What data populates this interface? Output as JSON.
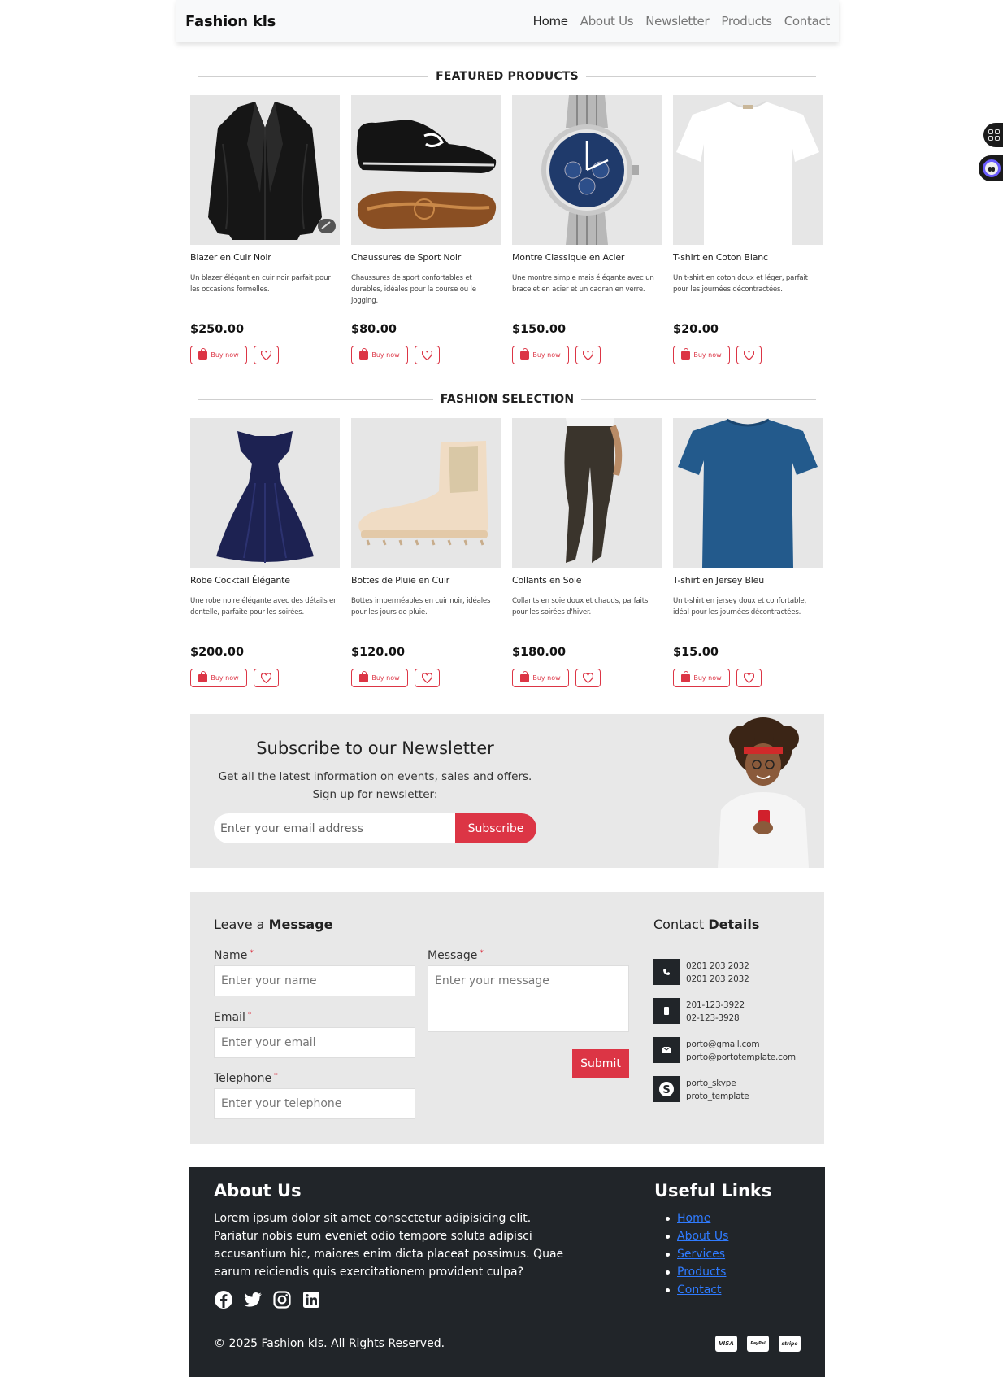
{
  "navbar": {
    "brand": "Fashion kls",
    "links": [
      {
        "label": "Home",
        "active": true
      },
      {
        "label": "About Us",
        "active": false
      },
      {
        "label": "Newsletter",
        "active": false
      },
      {
        "label": "Products",
        "active": false
      },
      {
        "label": "Contact",
        "active": false
      }
    ]
  },
  "featured": {
    "title": "FEATURED PRODUCTS",
    "products": [
      {
        "name": "Blazer en Cuir Noir",
        "desc": "Un blazer élégant en cuir noir parfait pour les occasions formelles.",
        "price": "$250.00",
        "image": "leather-jacket"
      },
      {
        "name": "Chaussures de Sport Noir",
        "desc": "Chaussures de sport confortables et durables, idéales pour la course ou le jogging.",
        "price": "$80.00",
        "image": "sport-shoes"
      },
      {
        "name": "Montre Classique en Acier",
        "desc": "Une montre simple mais élégante avec un bracelet en acier et un cadran en verre.",
        "price": "$150.00",
        "image": "steel-watch"
      },
      {
        "name": "T-shirt en Coton Blanc",
        "desc": "Un t-shirt en coton doux et léger, parfait pour les journées décontractées.",
        "price": "$20.00",
        "image": "white-tshirt"
      }
    ]
  },
  "fashion": {
    "title": "FASHION SELECTION",
    "products": [
      {
        "name": "Robe Cocktail Élégante",
        "desc": "Une robe noire élégante avec des détails en dentelle, parfaite pour les soirées.",
        "price": "$200.00",
        "image": "cocktail-dress"
      },
      {
        "name": "Bottes de Pluie en Cuir",
        "desc": "Bottes imperméables en cuir noir, idéales pour les jours de pluie.",
        "price": "$120.00",
        "image": "rain-boots"
      },
      {
        "name": "Collants en Soie",
        "desc": "Collants en soie doux et chauds, parfaits pour les soirées d'hiver.",
        "price": "$180.00",
        "image": "silk-tights"
      },
      {
        "name": "T-shirt en Jersey Bleu",
        "desc": "Un t-shirt en jersey doux et confortable, idéal pour les journées décontractées.",
        "price": "$15.00",
        "image": "blue-tshirt"
      }
    ]
  },
  "card": {
    "buy_label": "Buy now"
  },
  "newsletter": {
    "title": "Subscribe to our Newsletter",
    "line1": "Get all the latest information on events, sales and offers.",
    "line2": "Sign up for newsletter:",
    "placeholder": "Enter your email address",
    "button": "Subscribe"
  },
  "contact": {
    "title_light": "Leave a ",
    "title_bold": "Message",
    "name_label": "Name",
    "name_placeholder": "Enter your name",
    "email_label": "Email",
    "email_placeholder": "Enter your email",
    "phone_label": "Telephone",
    "phone_placeholder": "Enter your telephone",
    "message_label": "Message",
    "message_placeholder": "Enter your message",
    "required_mark": "*",
    "submit": "Submit",
    "details_light": "Contact ",
    "details_bold": "Details",
    "details": [
      {
        "icon": "phone-icon",
        "line1": "0201 203 2032",
        "line2": "0201 203 2032"
      },
      {
        "icon": "mobile-icon",
        "line1": "201-123-3922",
        "line2": "02-123-3928"
      },
      {
        "icon": "envelope-icon",
        "line1": "porto@gmail.com",
        "line2": "porto@portotemplate.com"
      },
      {
        "icon": "skype-icon",
        "line1": "porto_skype",
        "line2": "proto_template"
      }
    ]
  },
  "footer": {
    "about_title": "About Us",
    "about_text": "Lorem ipsum dolor sit amet consectetur adipisicing elit. Pariatur nobis eum eveniet odio tempore soluta adipisci accusantium hic, maiores enim dicta placeat possimus. Quae earum reiciendis quis exercitationem provident culpa?",
    "links_title": "Useful Links",
    "links": [
      "Home",
      "About Us",
      "Services",
      "Products",
      "Contact"
    ],
    "copyright": "© 2025 Fashion kls. All Rights Reserved.",
    "payments": [
      "VISA",
      "PayPal",
      "stripe"
    ],
    "social": [
      "facebook-icon",
      "twitter-icon",
      "instagram-icon",
      "linkedin-icon"
    ]
  },
  "colors": {
    "accent": "#dc3545",
    "footer_bg": "#212529",
    "panel_bg": "#e8e8e8",
    "card_bg": "#e6e6e6"
  }
}
